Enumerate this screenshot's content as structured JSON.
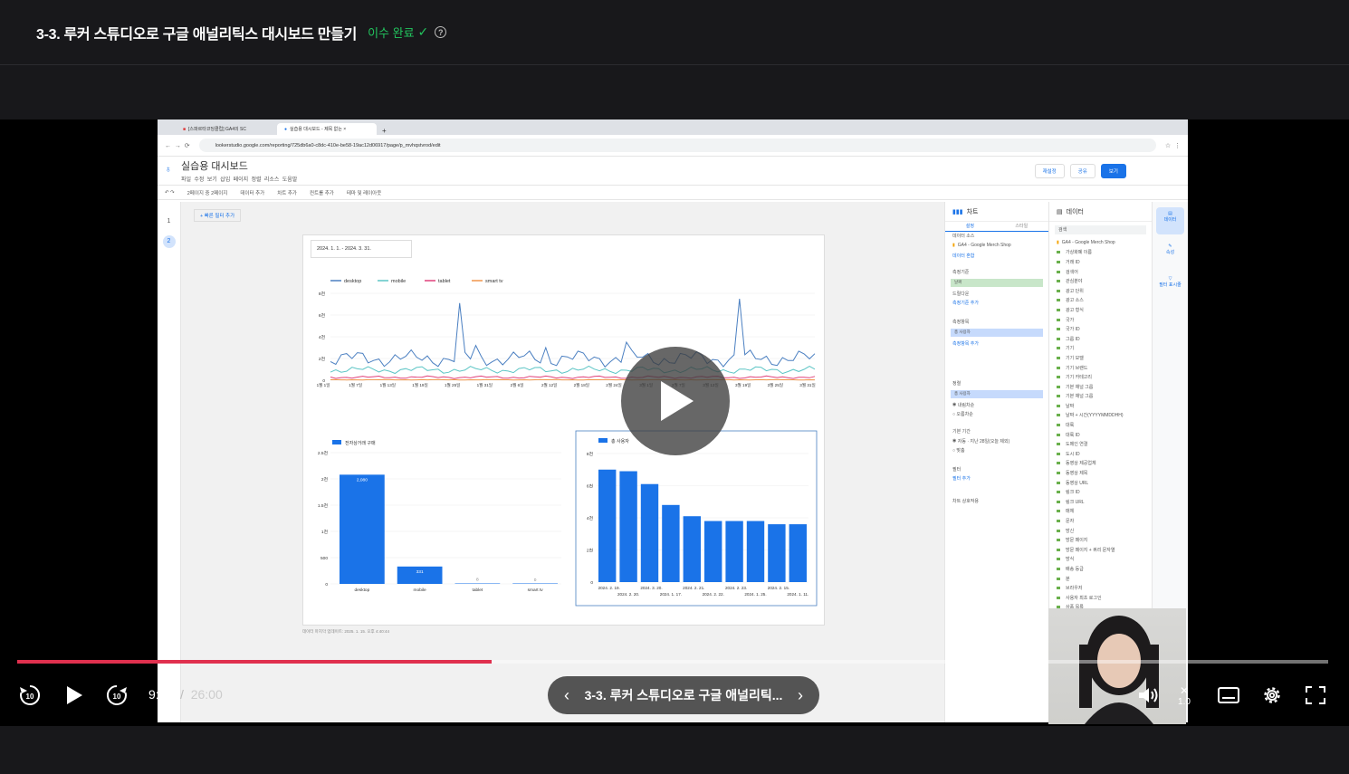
{
  "lesson": {
    "title": "3-3. 루커 스튜디오로 구글 애널리틱스 대시보드 만들기",
    "status_label": "이수 완료",
    "help_label": "?"
  },
  "browser": {
    "tabs": [
      "[스파르타코딩클럽] GA4의 SC",
      "실습용 대시보드 - 제목 없는 ×"
    ],
    "url": "lookerstudio.google.com/reporting/725db6a0-c8dc-410e-be58-19ac12d06917/page/p_mvhqstvrod/edit"
  },
  "looker": {
    "report_title": "실습용 대시보드",
    "menu": [
      "파일",
      "수정",
      "보기",
      "삽입",
      "페이지",
      "정렬",
      "리소스",
      "도움말"
    ],
    "buttons": {
      "reset": "재설정",
      "share": "공유",
      "view": "보기"
    },
    "toolbar": [
      "2페이지 중 2페이지",
      "데이터 추가",
      "차트 추가",
      "컨트롤 추가",
      "테마 및 레이아웃"
    ],
    "filter_label": "+ 빠른 필터 추가",
    "pages": [
      "1",
      "2"
    ],
    "date_range": "2024. 1. 1. - 2024. 3. 31.",
    "footer_note": "데이터 마지막 업데이트: 2025. 1. 15. 오후 4:40:44",
    "chart_panel": {
      "title": "차트",
      "tabs": [
        "설정",
        "스타일"
      ],
      "data_source_label": "데이터 소스",
      "data_source": "GA4 - Google Merch Shop",
      "blend_label": "데이터 혼합",
      "dimension_label": "측정기준",
      "dimension": "날짜",
      "drilldown_label": "드릴다운",
      "add_dimension": "측정기준 추가",
      "metric_label": "측정항목",
      "metric": "총 사용자",
      "add_metric": "측정항목 추가",
      "sort_label": "정렬",
      "sort_field": "총 사용자",
      "sort_options": [
        "내림차순",
        "오름차순"
      ],
      "period_label": "기본 기간",
      "period_options": [
        "자동 · 지난 28일(오늘 제외)",
        "맞춤"
      ],
      "filter_section": "필터",
      "add_filter": "필터 추가",
      "interaction_label": "차트 상호작용"
    },
    "data_panel": {
      "title": "데이터",
      "search_placeholder": "검색",
      "source": "GA4 - Google Merch Shop",
      "fields": [
        "가상화폐 이름",
        "거래 ID",
        "검색어",
        "관심분야",
        "광고 단위",
        "광고 소스",
        "광고 형식",
        "국가",
        "국가 ID",
        "그룹 ID",
        "기기",
        "기기 모델",
        "기기 브랜드",
        "기기 카테고리",
        "기본 채널 그룹",
        "기본 채널 그룹",
        "날짜",
        "날짜 + 시간(YYYYMMDDHH)",
        "대륙",
        "대륙 ID",
        "도메인 연결",
        "도시 ID",
        "동영상 제공업체",
        "동영상 제목",
        "동영상 URL",
        "링크 ID",
        "링크 URL",
        "매체",
        "문자",
        "방신",
        "방문 페이지",
        "방문 페이지 + 쿼리 문자열",
        "방식",
        "배송 등급",
        "분",
        "브라우저",
        "사용자 최초 로그인",
        "상품 목록",
        "상품 목록",
        "상품 목록",
        "상품 브랜드",
        "상품 카테",
        "상품 카테"
      ]
    },
    "right_tabs": [
      "데이터",
      "속성",
      "필터 표시줄"
    ]
  },
  "line_chart": {
    "legend": [
      "desktop",
      "mobile",
      "tablet",
      "smart tv"
    ],
    "colors": [
      "#4a7fc1",
      "#5cc5c5",
      "#e0407a",
      "#f0964a"
    ],
    "y_ticks": [
      "0",
      "2천",
      "4천",
      "6천",
      "8천"
    ],
    "x_ticks": [
      "1월 1일",
      "1월 7일",
      "1월 13일",
      "1월 19일",
      "1월 25일",
      "1월 31일",
      "2월 6일",
      "2월 12일",
      "2월 18일",
      "2월 24일",
      "3월 1일",
      "3월 7일",
      "3월 13일",
      "3월 19일",
      "3월 25일",
      "3월 31일"
    ]
  },
  "bar_chart_1": {
    "legend": "전자상거래 구매",
    "color": "#1a73e8",
    "categories": [
      "desktop",
      "mobile",
      "tablet",
      "smart tv"
    ],
    "values": [
      2080,
      331,
      8,
      0
    ],
    "labels": [
      "2,080",
      "331",
      "8",
      "0"
    ],
    "y_ticks": [
      "0",
      "500",
      "1천",
      "1.5천",
      "2천",
      "2.5천"
    ]
  },
  "bar_chart_2": {
    "legend": "총 사용자",
    "color": "#1a73e8",
    "values": [
      7.0,
      6.9,
      6.1,
      4.8,
      4.1,
      3.8,
      3.8,
      3.8,
      3.6,
      3.6
    ],
    "y_ticks": [
      "0",
      "2천",
      "4천",
      "6천",
      "8천"
    ],
    "x_top": [
      "2024. 2. 19.",
      "2024. 3. 20.",
      "2024. 2. 21.",
      "2024. 2. 23.",
      "2024. 2. 15."
    ],
    "x_bottom": [
      "2024. 2. 20.",
      "2024. 1. 17.",
      "2024. 2. 22.",
      "2024. 1. 25.",
      "2024. 1. 11."
    ]
  },
  "player": {
    "current_time": "9:26",
    "separator": "/",
    "duration": "26:00",
    "progress": 0.362,
    "chapter_title": "3-3. 루커 스튜디오로 구글 애널리틱...",
    "skip_seconds": "10",
    "speed": "1.0",
    "accent": "#e0304e"
  }
}
